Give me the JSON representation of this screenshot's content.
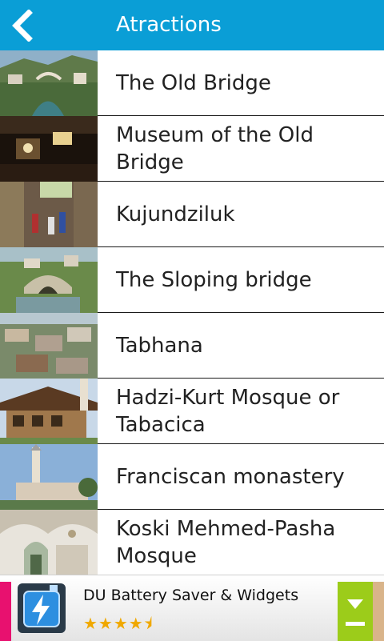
{
  "header": {
    "title": "Atractions"
  },
  "items": [
    {
      "label": "The Old Bridge"
    },
    {
      "label": "Museum of the Old Bridge"
    },
    {
      "label": "Kujundziluk"
    },
    {
      "label": "The Sloping bridge"
    },
    {
      "label": "Tabhana"
    },
    {
      "label": "Hadzi-Kurt Mosque or Tabacica"
    },
    {
      "label": "Franciscan monastery"
    },
    {
      "label": "Koski Mehmed-Pasha Mosque"
    }
  ],
  "ad": {
    "title": "DU Battery Saver & Widgets",
    "rating": 4.5,
    "stars": "★★★★⯨",
    "icon": "battery-bolt-icon",
    "button_icon": "download-arrow-icon"
  },
  "colors": {
    "header": "#0a9ed6",
    "ad_button": "#9ccc1a",
    "stars": "#f0a800"
  }
}
